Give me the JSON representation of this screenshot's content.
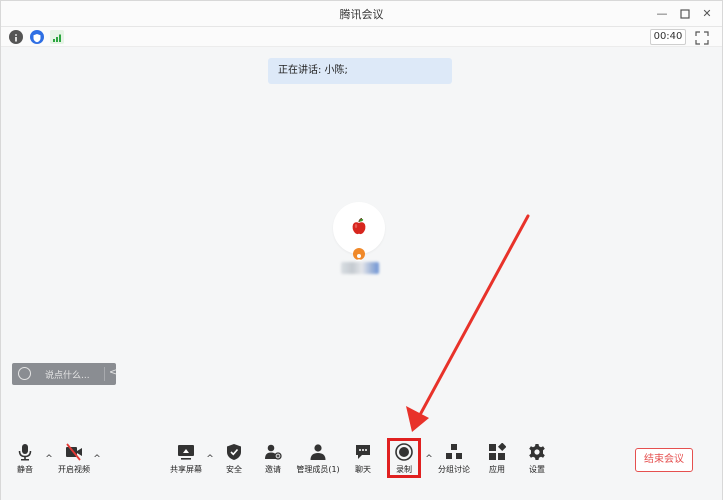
{
  "window": {
    "title": "腾讯会议"
  },
  "status": {
    "timer": "00:40"
  },
  "speaking": {
    "text": "正在讲话: 小陈;"
  },
  "chat": {
    "placeholder": "说点什么..."
  },
  "toolbar": {
    "mute": "静音",
    "video": "开启视频",
    "share": "共享屏幕",
    "security": "安全",
    "invite": "邀请",
    "manage": "管理成员(1)",
    "chat": "聊天",
    "record": "录制",
    "breakout": "分组讨论",
    "apps": "应用",
    "settings": "设置",
    "end": "结束会议"
  },
  "colors": {
    "accent": "#2f6fe4",
    "danger": "#e5504f",
    "highlight": "#e02020"
  }
}
